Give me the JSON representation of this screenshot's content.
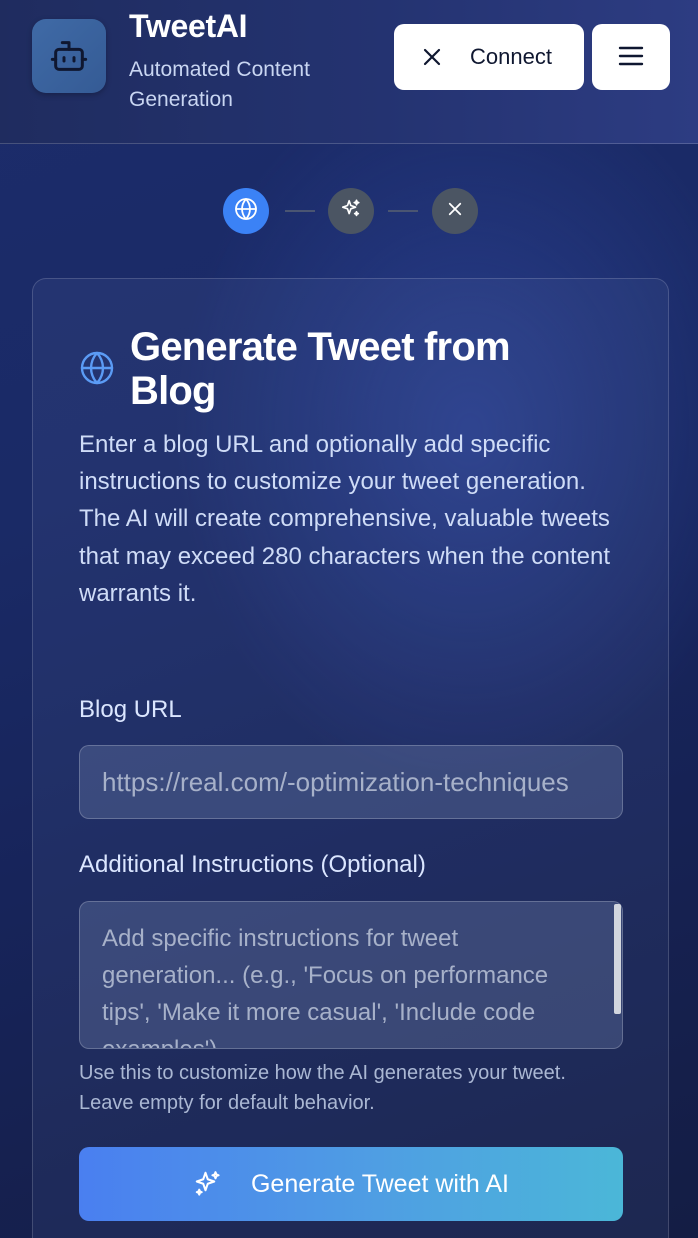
{
  "header": {
    "title": "TweetAI",
    "subtitle": "Automated Content Generation",
    "connect_label": "Connect",
    "logo_icon": "robot-icon",
    "menu_icon": "hamburger-menu-icon"
  },
  "stepper": {
    "steps": [
      {
        "icon": "globe-icon",
        "state": "active"
      },
      {
        "icon": "sparkles-icon",
        "state": "inactive"
      },
      {
        "icon": "close-icon",
        "state": "inactive"
      }
    ]
  },
  "card": {
    "title": "Generate Tweet from Blog",
    "description": "Enter a blog URL and optionally add specific instructions to customize your tweet generation. The AI will create comprehensive, valuable tweets that may exceed 280 characters when the content warrants it.",
    "url_label": "Blog URL",
    "url_placeholder": "https://real.com/-optimization-techniques",
    "instructions_label": "Additional Instructions (Optional)",
    "instructions_placeholder": "Add specific instructions for tweet generation... (e.g., 'Focus on performance tips', 'Make it more casual', 'Include code examples')",
    "help_text": "Use this to customize how the AI generates your tweet. Leave empty for default behavior.",
    "generate_label": "Generate Tweet with AI"
  },
  "colors": {
    "accent": "#3b82f6",
    "inactive_step": "#4b5563",
    "button_gradient_start": "#4a7ff0",
    "button_gradient_end": "#4bb7d8"
  }
}
